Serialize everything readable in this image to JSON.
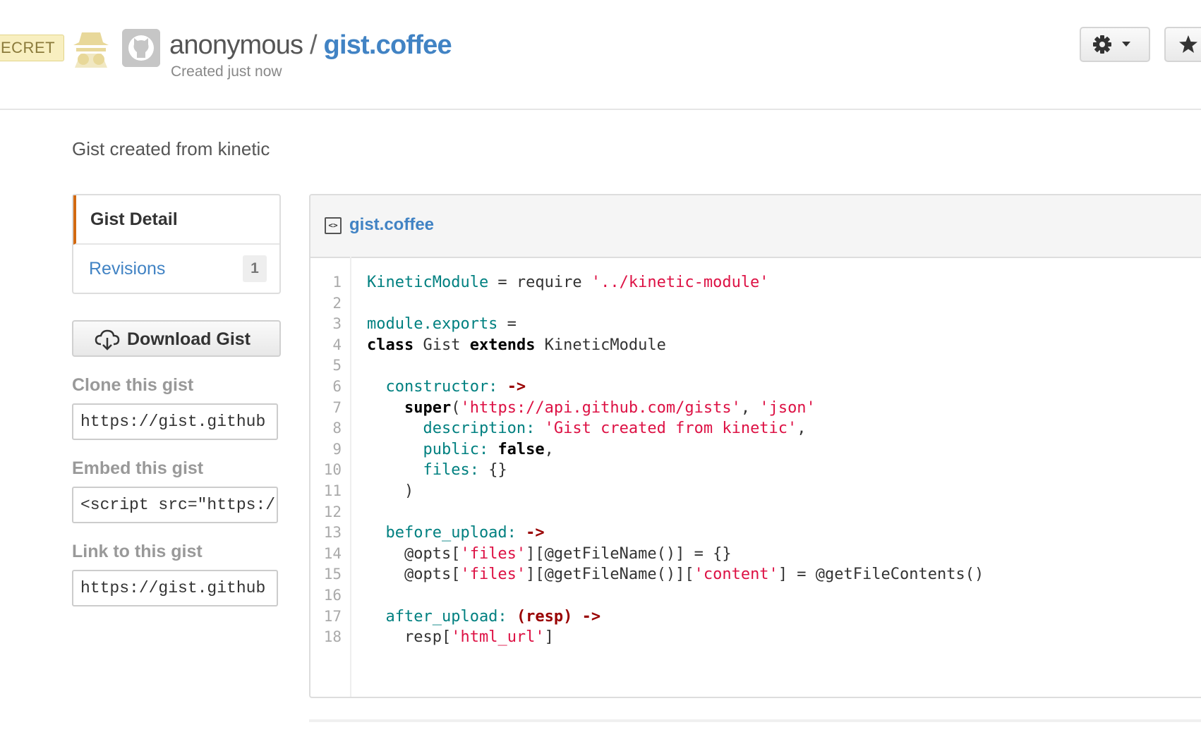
{
  "header": {
    "badge": "ECRET",
    "owner": "anonymous",
    "separator": " / ",
    "gist_name": "gist.coffee",
    "created": "Created just now"
  },
  "description": "Gist created from kinetic",
  "sidebar": {
    "nav": {
      "detail_label": "Gist Detail",
      "revisions_label": "Revisions",
      "revisions_count": "1"
    },
    "download_label": "Download Gist",
    "clone_label": "Clone this gist",
    "clone_value": "https://gist.github",
    "embed_label": "Embed this gist",
    "embed_value": "<script src=\"https:/",
    "link_label": "Link to this gist",
    "link_value": "https://gist.github"
  },
  "file": {
    "name": "gist.coffee",
    "line_numbers": [
      "1",
      "2",
      "3",
      "4",
      "5",
      "6",
      "7",
      "8",
      "9",
      "10",
      "11",
      "12",
      "13",
      "14",
      "15",
      "16",
      "17",
      "18"
    ],
    "lines": [
      [
        {
          "t": "KineticModule",
          "c": "var"
        },
        {
          "t": " = require ",
          "c": "plain"
        },
        {
          "t": "'../kinetic-module'",
          "c": "str"
        }
      ],
      [],
      [
        {
          "t": "module.exports",
          "c": "var"
        },
        {
          "t": " =",
          "c": "plain"
        }
      ],
      [
        {
          "t": "class",
          "c": "kw"
        },
        {
          "t": " Gist ",
          "c": "plain"
        },
        {
          "t": "extends",
          "c": "kw"
        },
        {
          "t": " KineticModule",
          "c": "plain"
        }
      ],
      [],
      [
        {
          "t": "  constructor:",
          "c": "var"
        },
        {
          "t": " ",
          "c": "plain"
        },
        {
          "t": "->",
          "c": "fn"
        }
      ],
      [
        {
          "t": "    ",
          "c": "plain"
        },
        {
          "t": "super",
          "c": "kw"
        },
        {
          "t": "(",
          "c": "plain"
        },
        {
          "t": "'https://api.github.com/gists'",
          "c": "str"
        },
        {
          "t": ", ",
          "c": "plain"
        },
        {
          "t": "'json'",
          "c": "str"
        }
      ],
      [
        {
          "t": "      description:",
          "c": "var"
        },
        {
          "t": " ",
          "c": "plain"
        },
        {
          "t": "'Gist created from kinetic'",
          "c": "str"
        },
        {
          "t": ",",
          "c": "plain"
        }
      ],
      [
        {
          "t": "      public:",
          "c": "var"
        },
        {
          "t": " ",
          "c": "plain"
        },
        {
          "t": "false",
          "c": "kw"
        },
        {
          "t": ",",
          "c": "plain"
        }
      ],
      [
        {
          "t": "      files:",
          "c": "var"
        },
        {
          "t": " {}",
          "c": "plain"
        }
      ],
      [
        {
          "t": "    )",
          "c": "plain"
        }
      ],
      [],
      [
        {
          "t": "  before_upload:",
          "c": "var"
        },
        {
          "t": " ",
          "c": "plain"
        },
        {
          "t": "->",
          "c": "fn"
        }
      ],
      [
        {
          "t": "    @opts[",
          "c": "plain"
        },
        {
          "t": "'files'",
          "c": "str"
        },
        {
          "t": "][@getFileName()] = {}",
          "c": "plain"
        }
      ],
      [
        {
          "t": "    @opts[",
          "c": "plain"
        },
        {
          "t": "'files'",
          "c": "str"
        },
        {
          "t": "][@getFileName()][",
          "c": "plain"
        },
        {
          "t": "'content'",
          "c": "str"
        },
        {
          "t": "] = @getFileContents()",
          "c": "plain"
        }
      ],
      [],
      [
        {
          "t": "  after_upload:",
          "c": "var"
        },
        {
          "t": " ",
          "c": "plain"
        },
        {
          "t": "(resp)",
          "c": "fn"
        },
        {
          "t": " ",
          "c": "plain"
        },
        {
          "t": "->",
          "c": "fn"
        }
      ],
      [
        {
          "t": "    resp[",
          "c": "plain"
        },
        {
          "t": "'html_url'",
          "c": "str"
        },
        {
          "t": "]",
          "c": "plain"
        }
      ]
    ]
  },
  "colors": {
    "link": "#4183c4",
    "accent": "#d26911",
    "string": "#d14",
    "variable": "#008080"
  }
}
